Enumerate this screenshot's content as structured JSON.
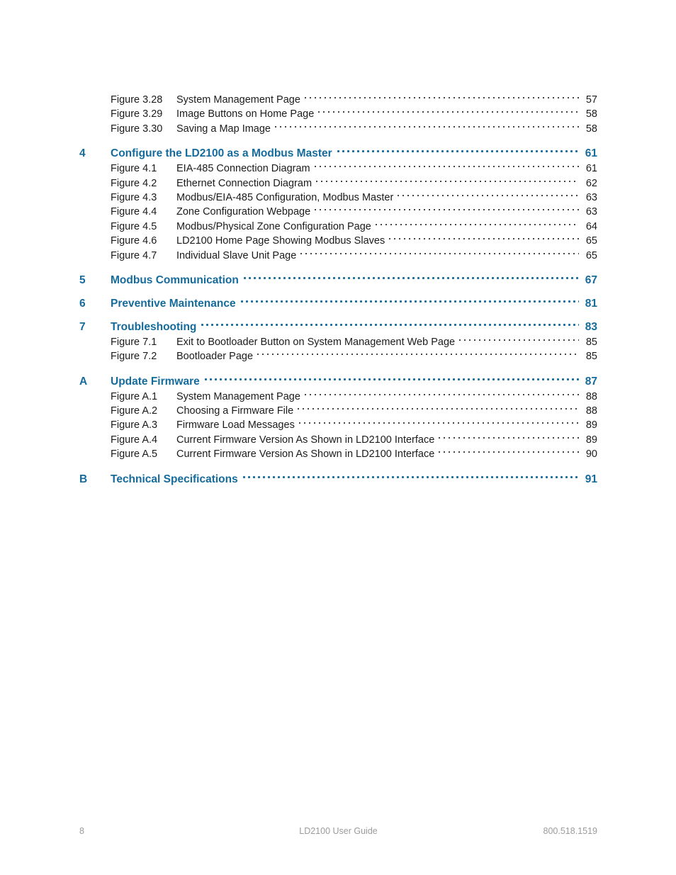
{
  "document": {
    "page_number": "8",
    "running_title": "LD2100 User Guide",
    "phone": "800.518.1519"
  },
  "colors": {
    "heading_blue": "#156b9c",
    "body_black": "#1b1b1b",
    "footer_gray": "#9b9b9b"
  },
  "toc": {
    "entries": [
      {
        "kind": "figure",
        "label": "Figure 3.28",
        "name": "System Management Page",
        "page": "57"
      },
      {
        "kind": "figure",
        "label": "Figure 3.29",
        "name": "Image Buttons on Home Page",
        "page": "58"
      },
      {
        "kind": "figure",
        "label": "Figure 3.30",
        "name": "Saving a Map Image",
        "page": "58"
      },
      {
        "kind": "section",
        "number": "4",
        "title": "Configure the LD2100 as a Modbus Master",
        "page": "61"
      },
      {
        "kind": "figure",
        "label": "Figure 4.1",
        "name": "EIA-485 Connection Diagram",
        "page": "61"
      },
      {
        "kind": "figure",
        "label": "Figure 4.2",
        "name": "Ethernet Connection Diagram",
        "page": "62"
      },
      {
        "kind": "figure",
        "label": "Figure 4.3",
        "name": "Modbus/EIA-485 Configuration, Modbus Master",
        "page": "63"
      },
      {
        "kind": "figure",
        "label": "Figure 4.4",
        "name": "Zone Configuration Webpage",
        "page": "63"
      },
      {
        "kind": "figure",
        "label": "Figure 4.5",
        "name": "Modbus/Physical Zone Configuration Page",
        "page": "64"
      },
      {
        "kind": "figure",
        "label": "Figure 4.6",
        "name": "LD2100 Home Page Showing Modbus Slaves",
        "page": "65"
      },
      {
        "kind": "figure",
        "label": "Figure 4.7",
        "name": "Individual Slave Unit Page",
        "page": "65"
      },
      {
        "kind": "section",
        "number": "5",
        "title": "Modbus Communication",
        "page": "67"
      },
      {
        "kind": "section",
        "number": "6",
        "title": "Preventive Maintenance",
        "page": "81"
      },
      {
        "kind": "section",
        "number": "7",
        "title": "Troubleshooting",
        "page": "83"
      },
      {
        "kind": "figure",
        "label": "Figure 7.1",
        "name": "Exit to Bootloader Button on System Management Web Page",
        "page": "85"
      },
      {
        "kind": "figure",
        "label": "Figure 7.2",
        "name": "Bootloader Page",
        "page": "85"
      },
      {
        "kind": "section",
        "number": "A",
        "title": "Update Firmware",
        "page": "87"
      },
      {
        "kind": "figure",
        "label": "Figure A.1",
        "name": "System Management Page",
        "page": "88"
      },
      {
        "kind": "figure",
        "label": "Figure A.2",
        "name": "Choosing a Firmware File",
        "page": "88"
      },
      {
        "kind": "figure",
        "label": "Figure A.3",
        "name": "Firmware Load Messages",
        "page": "89"
      },
      {
        "kind": "figure",
        "label": "Figure A.4",
        "name": "Current Firmware Version As Shown in LD2100 Interface",
        "page": "89"
      },
      {
        "kind": "figure",
        "label": "Figure A.5",
        "name": "Current Firmware Version As Shown in LD2100 Interface",
        "page": "90"
      },
      {
        "kind": "section",
        "number": "B",
        "title": "Technical Specifications",
        "page": "91"
      }
    ]
  }
}
